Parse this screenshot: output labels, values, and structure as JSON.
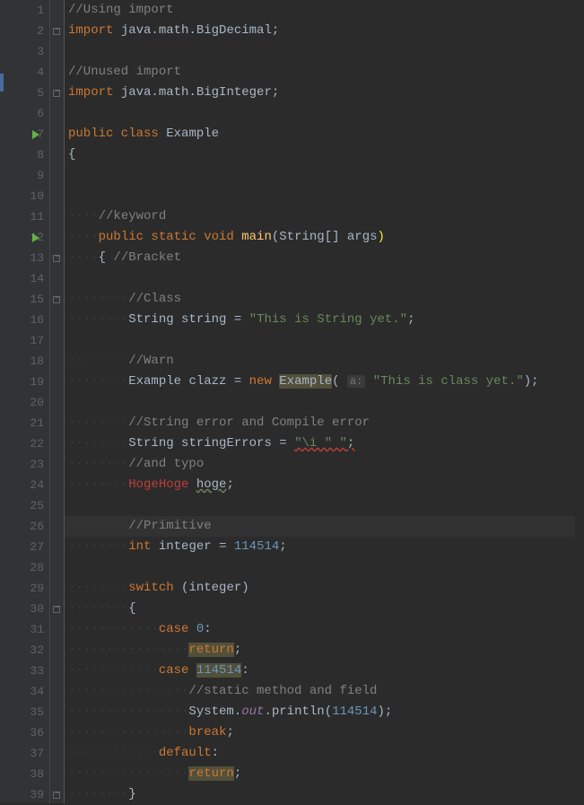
{
  "lines": [
    {
      "num": "1"
    },
    {
      "num": "2",
      "fold": true
    },
    {
      "num": "3"
    },
    {
      "num": "4"
    },
    {
      "num": "5",
      "fold": true
    },
    {
      "num": "6"
    },
    {
      "num": "7",
      "run": true
    },
    {
      "num": "8"
    },
    {
      "num": "9"
    },
    {
      "num": "10"
    },
    {
      "num": "11"
    },
    {
      "num": "12",
      "run": true
    },
    {
      "num": "13",
      "fold": true
    },
    {
      "num": "14"
    },
    {
      "num": "15",
      "fold": true
    },
    {
      "num": "16"
    },
    {
      "num": "17"
    },
    {
      "num": "18"
    },
    {
      "num": "19"
    },
    {
      "num": "20"
    },
    {
      "num": "21"
    },
    {
      "num": "22"
    },
    {
      "num": "23"
    },
    {
      "num": "24"
    },
    {
      "num": "25"
    },
    {
      "num": "26"
    },
    {
      "num": "27"
    },
    {
      "num": "28"
    },
    {
      "num": "29"
    },
    {
      "num": "30",
      "fold": true
    },
    {
      "num": "31"
    },
    {
      "num": "32"
    },
    {
      "num": "33"
    },
    {
      "num": "34"
    },
    {
      "num": "35"
    },
    {
      "num": "36"
    },
    {
      "num": "37"
    },
    {
      "num": "38"
    },
    {
      "num": "39",
      "fold": true
    }
  ],
  "c1": "//Using import",
  "c2a": "import",
  "c2b": "java.math.BigDecimal",
  "c4": "//Unused import",
  "c5a": "import",
  "c5b": "java.math.BigInteger",
  "c7a": "public class",
  "c7b": "Example",
  "c11": "//keyword",
  "c12a": "public static void",
  "c12b": "main",
  "c12c": "String",
  "c12d": "args",
  "c13": "//Bracket",
  "c15": "//Class",
  "c16a": "String",
  "c16b": "string",
  "c16c": "\"This is String yet.\"",
  "c18": "//Warn",
  "c19a": "Example",
  "c19b": "clazz",
  "c19c": "new",
  "c19d": "Example",
  "c19h": "a:",
  "c19e": "\"This is class yet.\"",
  "c21": "//String error and Compile error",
  "c22a": "String",
  "c22b": "stringErrors",
  "c22c": "\"\\i \"",
  "c22d": " \"",
  "c22e": ";",
  "c23": "//and typo",
  "c24a": "HogeHoge",
  "c24b": "hoge",
  "c26": "//Primitive",
  "c27a": "int",
  "c27b": "integer",
  "c27c": "114514",
  "c29a": "switch",
  "c29b": "integer",
  "c31a": "case",
  "c31b": "0",
  "c32": "return",
  "c33a": "case",
  "c33b": "114514",
  "c34": "//static method and field",
  "c35a": "System",
  "c35b": "out",
  "c35c": "println",
  "c35d": "114514",
  "c36": "break",
  "c37": "default",
  "c38": "return"
}
